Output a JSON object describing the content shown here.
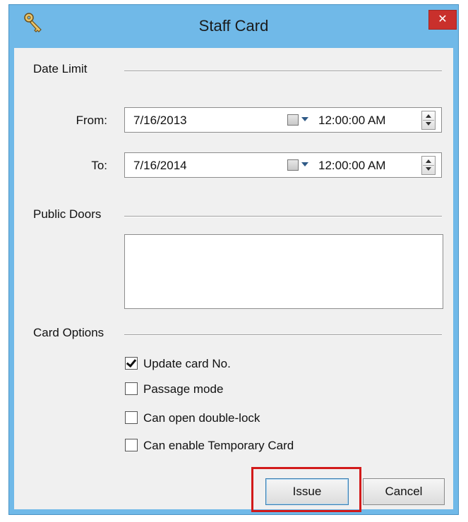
{
  "window": {
    "title": "Staff Card",
    "close_glyph": "✕",
    "icon": "key-icon"
  },
  "date_limit": {
    "group_label": "Date Limit",
    "from": {
      "label": "From:",
      "date": "7/16/2013",
      "time": "12:00:00 AM"
    },
    "to": {
      "label": "To:",
      "date": "7/16/2014",
      "time": "12:00:00 AM"
    }
  },
  "public_doors": {
    "group_label": "Public Doors",
    "items": []
  },
  "card_options": {
    "group_label": "Card Options",
    "options": [
      {
        "label": "Update card No.",
        "checked": true
      },
      {
        "label": "Passage mode",
        "checked": false
      },
      {
        "label": "Can open double-lock",
        "checked": false
      },
      {
        "label": "Can enable Temporary Card",
        "checked": false
      }
    ]
  },
  "buttons": {
    "issue_label": "Issue",
    "cancel_label": "Cancel"
  },
  "colors": {
    "title_bar": "#70b9e8",
    "close_button": "#c9302c",
    "highlight": "#d21a1a"
  }
}
